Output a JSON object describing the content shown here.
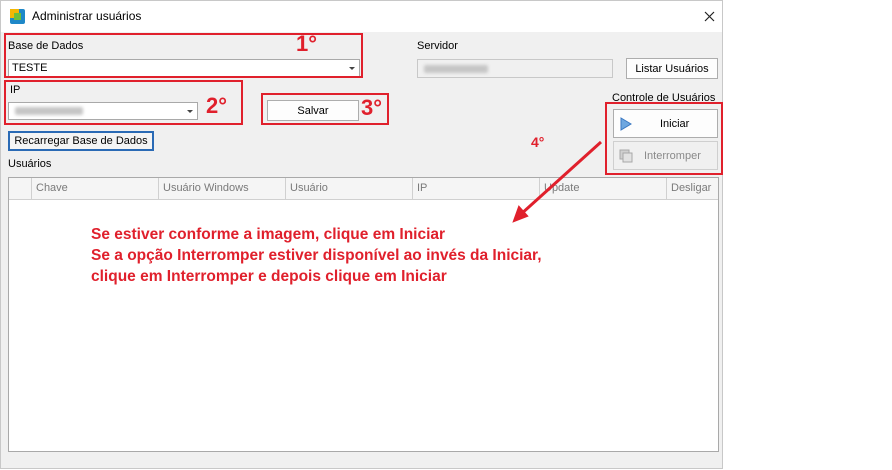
{
  "window": {
    "title": "Administrar usuários"
  },
  "database": {
    "label": "Base de Dados",
    "value": "TESTE"
  },
  "server": {
    "label": "Servidor"
  },
  "ip": {
    "label": "IP"
  },
  "buttons": {
    "list_users": "Listar Usuários",
    "save": "Salvar",
    "reload_db": "Recarregar Base de Dados",
    "start": "Iniciar",
    "stop": "Interromper"
  },
  "user_control": {
    "label": "Controle de Usuários"
  },
  "users": {
    "label": "Usuários",
    "columns": [
      "Chave",
      "Usuário Windows",
      "Usuário",
      "IP",
      "Update",
      "Desligar"
    ]
  },
  "annotations": {
    "step1": "1°",
    "step2": "2°",
    "step3": "3°",
    "step4": "4°",
    "instructions": [
      "Se estiver conforme a imagem, clique em Iniciar",
      "Se a opção Interromper estiver disponível ao invés da Iniciar,",
      "clique em Interromper e depois clique em Iniciar"
    ]
  },
  "colors": {
    "annotation_red": "#e0202c",
    "focus_blue": "#2a6ab5"
  }
}
